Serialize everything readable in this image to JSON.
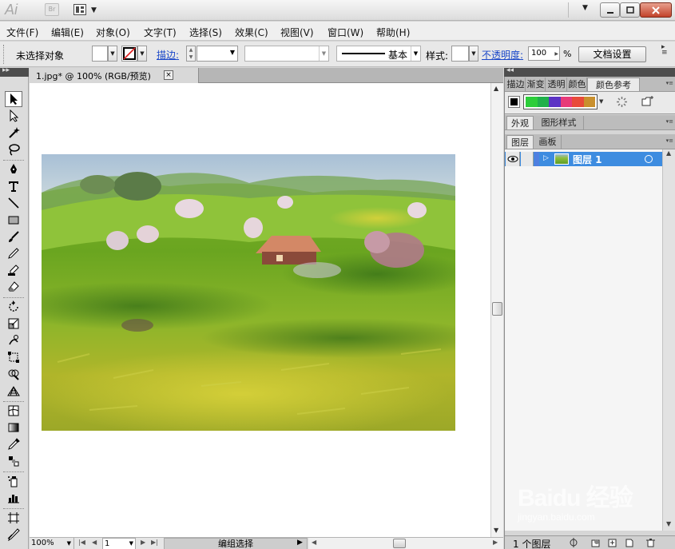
{
  "app": {
    "logo": "Ai",
    "bridge_label": "Br"
  },
  "menubar": {
    "items": [
      "文件(F)",
      "编辑(E)",
      "对象(O)",
      "文字(T)",
      "选择(S)",
      "效果(C)",
      "视图(V)",
      "窗口(W)",
      "帮助(H)"
    ]
  },
  "controlbar": {
    "selection_label": "未选择对象",
    "stroke_label": "描边:",
    "brush_label": "基本",
    "style_label": "样式:",
    "opacity_label": "不透明度:",
    "opacity_value": "100",
    "percent": "%",
    "doc_setup_label": "文档设置"
  },
  "document": {
    "tab_title": "1.jpg* @ 100% (RGB/预览)",
    "close_glyph": "×"
  },
  "statusbar": {
    "zoom": "100%",
    "page": "1",
    "status_text": "编组选择"
  },
  "panels": {
    "top_tabs": [
      "描边",
      "渐变",
      "透明",
      "颜色",
      "颜色参考"
    ],
    "middle_tabs": [
      "外观",
      "图形样式"
    ],
    "layer_tabs": [
      "图层",
      "画板"
    ],
    "color_guide_colors": [
      "#2ccd3a",
      "#20b04b",
      "#5c33c4",
      "#e83a78",
      "#e84b3a",
      "#c9902e"
    ],
    "layer": {
      "name": "图层 1"
    },
    "layer_count": "1 个图层"
  },
  "colors": {
    "layer_highlight": "#3d8ce0",
    "link_blue": "#1a47c9"
  },
  "watermark": {
    "logo": "Baidu 经验",
    "url": "jingyan.baidu.com"
  }
}
